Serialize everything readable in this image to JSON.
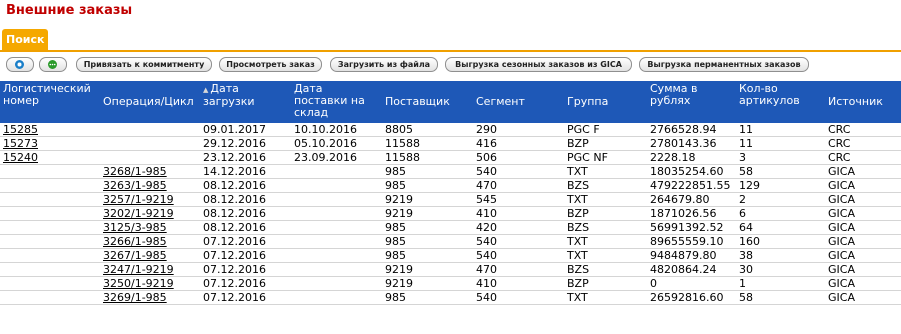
{
  "page": {
    "title": "Внешние заказы"
  },
  "tabs": [
    {
      "label": "Поиск",
      "active": true
    }
  ],
  "toolbar": {
    "icon_buttons": [
      {
        "icon": "settings-icon",
        "color": "#1a7fc9"
      },
      {
        "icon": "more-icon",
        "color": "#2b9a2b"
      }
    ],
    "buttons": [
      {
        "label": "Привязать к коммитменту"
      },
      {
        "label": "Просмотреть заказ"
      },
      {
        "label": "Загрузить из файла"
      },
      {
        "label": "Выгрузка сезонных заказов из GICA"
      },
      {
        "label": "Выгрузка перманентных заказов"
      }
    ]
  },
  "table": {
    "header_color": "#1e58b7",
    "sort_indicator": "▲",
    "sorted_column": "date_load",
    "columns": [
      {
        "key": "log_num",
        "label": "Логистический номер"
      },
      {
        "key": "operation",
        "label": "Операция/Цикл"
      },
      {
        "key": "date_load",
        "label": "Дата загрузки"
      },
      {
        "key": "date_delivery",
        "label": "Дата поставки на склад"
      },
      {
        "key": "supplier",
        "label": "Поставщик"
      },
      {
        "key": "segment",
        "label": "Сегмент"
      },
      {
        "key": "group",
        "label": "Группа"
      },
      {
        "key": "sum",
        "label": "Сумма в рублях"
      },
      {
        "key": "count",
        "label": "Кол-во артикулов"
      },
      {
        "key": "source",
        "label": "Источник"
      }
    ],
    "rows": [
      {
        "log_num": "15285",
        "operation": "",
        "date_load": "09.01.2017",
        "date_delivery": "10.10.2016",
        "supplier": "8805",
        "segment": "290",
        "group": "PGC F",
        "sum": "2766528.94",
        "count": "11",
        "source": "CRC"
      },
      {
        "log_num": "15273",
        "operation": "",
        "date_load": "29.12.2016",
        "date_delivery": "05.10.2016",
        "supplier": "11588",
        "segment": "416",
        "group": "BZP",
        "sum": "2780143.36",
        "count": "11",
        "source": "CRC"
      },
      {
        "log_num": "15240",
        "operation": "",
        "date_load": "23.12.2016",
        "date_delivery": "23.09.2016",
        "supplier": "11588",
        "segment": "506",
        "group": "PGC NF",
        "sum": "2228.18",
        "count": "3",
        "source": "CRC"
      },
      {
        "log_num": "",
        "operation": "3268/1-985",
        "date_load": "14.12.2016",
        "date_delivery": "",
        "supplier": "985",
        "segment": "540",
        "group": "TXT",
        "sum": "18035254.60",
        "count": "58",
        "source": "GICA"
      },
      {
        "log_num": "",
        "operation": "3263/1-985",
        "date_load": "08.12.2016",
        "date_delivery": "",
        "supplier": "985",
        "segment": "470",
        "group": "BZS",
        "sum": "479222851.55",
        "count": "129",
        "source": "GICA"
      },
      {
        "log_num": "",
        "operation": "3257/1-9219",
        "date_load": "08.12.2016",
        "date_delivery": "",
        "supplier": "9219",
        "segment": "545",
        "group": "TXT",
        "sum": "264679.80",
        "count": "2",
        "source": "GICA"
      },
      {
        "log_num": "",
        "operation": "3202/1-9219",
        "date_load": "08.12.2016",
        "date_delivery": "",
        "supplier": "9219",
        "segment": "410",
        "group": "BZP",
        "sum": "1871026.56",
        "count": "6",
        "source": "GICA"
      },
      {
        "log_num": "",
        "operation": "3125/3-985",
        "date_load": "08.12.2016",
        "date_delivery": "",
        "supplier": "985",
        "segment": "420",
        "group": "BZS",
        "sum": "56991392.52",
        "count": "64",
        "source": "GICA"
      },
      {
        "log_num": "",
        "operation": "3266/1-985",
        "date_load": "07.12.2016",
        "date_delivery": "",
        "supplier": "985",
        "segment": "540",
        "group": "TXT",
        "sum": "89655559.10",
        "count": "160",
        "source": "GICA"
      },
      {
        "log_num": "",
        "operation": "3267/1-985",
        "date_load": "07.12.2016",
        "date_delivery": "",
        "supplier": "985",
        "segment": "540",
        "group": "TXT",
        "sum": "9484879.80",
        "count": "38",
        "source": "GICA"
      },
      {
        "log_num": "",
        "operation": "3247/1-9219",
        "date_load": "07.12.2016",
        "date_delivery": "",
        "supplier": "9219",
        "segment": "470",
        "group": "BZS",
        "sum": "4820864.24",
        "count": "30",
        "source": "GICA"
      },
      {
        "log_num": "",
        "operation": "3250/1-9219",
        "date_load": "07.12.2016",
        "date_delivery": "",
        "supplier": "9219",
        "segment": "410",
        "group": "BZP",
        "sum": "0",
        "count": "1",
        "source": "GICA"
      },
      {
        "log_num": "",
        "operation": "3269/1-985",
        "date_load": "07.12.2016",
        "date_delivery": "",
        "supplier": "985",
        "segment": "540",
        "group": "TXT",
        "sum": "26592816.60",
        "count": "58",
        "source": "GICA"
      }
    ]
  }
}
